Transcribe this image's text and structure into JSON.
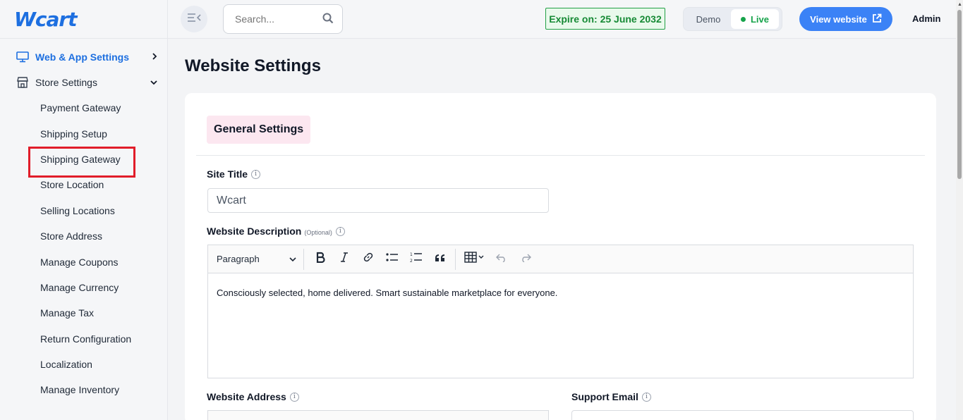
{
  "brand": {
    "logo_text": "Wcart",
    "accent": "#1d6fe0"
  },
  "sidebar": {
    "groups": [
      {
        "label": "Web & App Settings",
        "icon": "monitor-icon",
        "chevron": "›",
        "active": true
      },
      {
        "label": "Store Settings",
        "icon": "store-icon",
        "chevron": "⌄",
        "active": false
      }
    ],
    "items": [
      {
        "label": "Payment Gateway"
      },
      {
        "label": "Shipping Setup"
      },
      {
        "label": "Shipping Gateway"
      },
      {
        "label": "Store Location"
      },
      {
        "label": "Selling Locations"
      },
      {
        "label": "Store Address"
      },
      {
        "label": "Manage Coupons"
      },
      {
        "label": "Manage Currency"
      },
      {
        "label": "Manage Tax"
      },
      {
        "label": "Return Configuration"
      },
      {
        "label": "Localization"
      },
      {
        "label": "Manage Inventory"
      }
    ]
  },
  "header": {
    "search": {
      "placeholder": "Search..."
    },
    "expire_label": "Expire on: 25 June 2032",
    "mode": {
      "demo": "Demo",
      "live": "Live",
      "selected": "Live"
    },
    "view_website": "View website",
    "user": "Admin"
  },
  "main": {
    "title": "Website Settings",
    "section": "General Settings",
    "fields": {
      "site_title": {
        "label": "Site Title",
        "value": "Wcart"
      },
      "description": {
        "label": "Website Description",
        "optional": "(Optional)",
        "toolbar_style": "Paragraph",
        "content": "Consciously selected, home delivered. Smart sustainable marketplace for everyone."
      },
      "address": {
        "label": "Website Address"
      },
      "support_email": {
        "label": "Support Email"
      }
    }
  }
}
